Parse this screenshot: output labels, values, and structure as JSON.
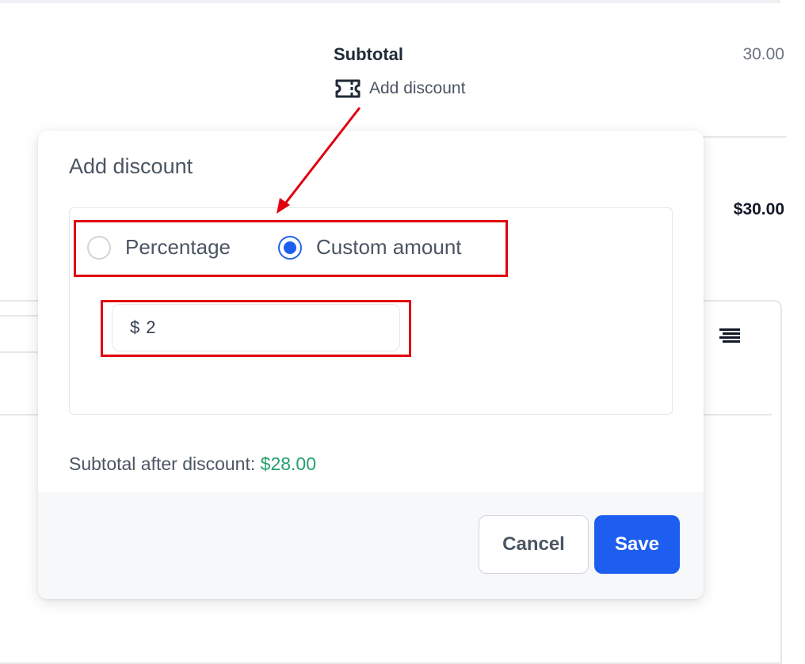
{
  "summary": {
    "subtotal_label": "Subtotal",
    "subtotal_value": "30.00",
    "add_discount_link": "Add discount",
    "total_value": "$30.00"
  },
  "modal": {
    "title": "Add discount",
    "options": [
      {
        "label": "Percentage",
        "checked": false
      },
      {
        "label": "Custom amount",
        "checked": true
      }
    ],
    "amount": {
      "currency": "$",
      "value": "2"
    },
    "subtotal_after_label": "Subtotal after discount:",
    "subtotal_after_value": "$28.00",
    "cancel_label": "Cancel",
    "save_label": "Save"
  },
  "colors": {
    "accent": "#1d5ef0",
    "success": "#22a06b",
    "annotation": "#e00010"
  },
  "icons": [
    "ticket-icon",
    "menu-dots-icon",
    "align-icon",
    "radio-checked-icon",
    "radio-unchecked-icon"
  ]
}
